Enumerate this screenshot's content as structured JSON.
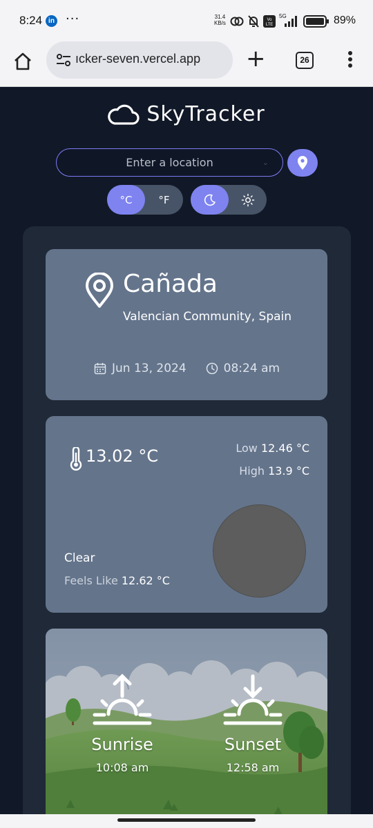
{
  "status_bar": {
    "time": "8:24",
    "app_badge": "in",
    "overflow": "···",
    "net_speed_value": "31.4",
    "net_speed_unit": "KB/s",
    "network": "5G",
    "battery": "89%",
    "icons": [
      "link-icon",
      "bell-off-icon",
      "volte-icon",
      "signal-icon",
      "battery-icon"
    ]
  },
  "browser": {
    "url": "ıcker-seven.vercel.app",
    "tab_count": "26",
    "icons": [
      "home-icon",
      "tune-icon",
      "plus-icon",
      "tabs-icon",
      "more-vert-icon"
    ]
  },
  "app": {
    "name": "SkyTracker",
    "search": {
      "placeholder": "Enter a location",
      "value": ""
    },
    "units": {
      "celsius": "°C",
      "fahrenheit": "°F",
      "selected": "celsius"
    },
    "theme": {
      "selected": "dark"
    },
    "accent_color": "#7e83f0",
    "location": {
      "city": "Cañada",
      "region": "Valencian Community, Spain",
      "date": "Jun 13, 2024",
      "time": "08:24 am"
    },
    "weather": {
      "temperature": "13.02 °C",
      "low_label": "Low",
      "low": "12.46 °C",
      "high_label": "High",
      "high": "13.9 °C",
      "description": "Clear",
      "feels_like_label": "Feels Like",
      "feels_like": "12.62 °C"
    },
    "sun": {
      "sunrise_label": "Sunrise",
      "sunrise_time": "10:08 am",
      "sunset_label": "Sunset",
      "sunset_time": "12:58 am"
    }
  }
}
